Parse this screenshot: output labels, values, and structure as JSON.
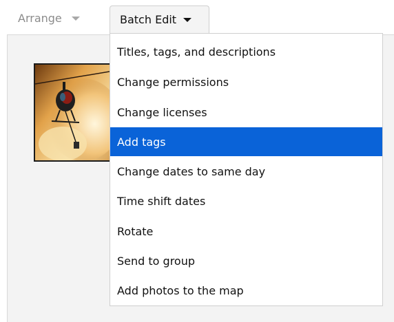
{
  "toolbar": {
    "arrange_label": "Arrange",
    "batch_edit_label": "Batch Edit"
  },
  "menu": {
    "items": [
      {
        "label": "Titles, tags, and descriptions",
        "highlighted": false
      },
      {
        "label": "Change permissions",
        "highlighted": false
      },
      {
        "label": "Change licenses",
        "highlighted": false
      },
      {
        "label": "Add tags",
        "highlighted": true
      },
      {
        "label": "Change dates to same day",
        "highlighted": false
      },
      {
        "label": "Time shift dates",
        "highlighted": false
      },
      {
        "label": "Rotate",
        "highlighted": false
      },
      {
        "label": "Send to group",
        "highlighted": false
      },
      {
        "label": "Add photos to the map",
        "highlighted": false
      }
    ]
  },
  "colors": {
    "highlight": "#0a63d8",
    "disabled_text": "#8c8c8c"
  }
}
